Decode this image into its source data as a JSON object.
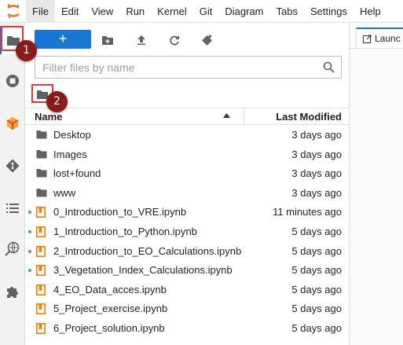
{
  "menubar": {
    "items": [
      "File",
      "Edit",
      "View",
      "Run",
      "Kernel",
      "Git",
      "Diagram",
      "Tabs",
      "Settings",
      "Help"
    ]
  },
  "activity_bar": {
    "icons": [
      "folder-icon",
      "stop-circle-icon",
      "extension-cube-icon",
      "git-icon",
      "list-icon",
      "map-search-icon",
      "puzzle-icon"
    ]
  },
  "toolbar": {
    "new_label": "+",
    "icons": [
      "new-folder-icon",
      "upload-icon",
      "refresh-icon",
      "git-clone-icon"
    ]
  },
  "search": {
    "placeholder": "Filter files by name"
  },
  "file_list": {
    "header_name": "Name",
    "header_modified": "Last Modified",
    "rows": [
      {
        "name": "Desktop",
        "type": "folder",
        "modified": "3 days ago",
        "running": false
      },
      {
        "name": "Images",
        "type": "folder",
        "modified": "3 days ago",
        "running": false
      },
      {
        "name": "lost+found",
        "type": "folder",
        "modified": "3 days ago",
        "running": false
      },
      {
        "name": "www",
        "type": "folder",
        "modified": "3 days ago",
        "running": false
      },
      {
        "name": "0_Introduction_to_VRE.ipynb",
        "type": "notebook",
        "modified": "11 minutes ago",
        "running": true
      },
      {
        "name": "1_Introduction_to_Python.ipynb",
        "type": "notebook",
        "modified": "5 days ago",
        "running": true
      },
      {
        "name": "2_Introduction_to_EO_Calculations.ipynb",
        "type": "notebook",
        "modified": "5 days ago",
        "running": true
      },
      {
        "name": "3_Vegetation_Index_Calculations.ipynb",
        "type": "notebook",
        "modified": "5 days ago",
        "running": true
      },
      {
        "name": "4_EO_Data_acces.ipynb",
        "type": "notebook",
        "modified": "5 days ago",
        "running": false
      },
      {
        "name": "5_Project_exercise.ipynb",
        "type": "notebook",
        "modified": "5 days ago",
        "running": false
      },
      {
        "name": "6_Project_solution.ipynb",
        "type": "notebook",
        "modified": "5 days ago",
        "running": false
      }
    ]
  },
  "launcher_tab": {
    "label": "Launc"
  },
  "annotations": {
    "badge1": "1",
    "badge2": "2"
  },
  "colors": {
    "accent": "#1976d2",
    "folder": "#616161",
    "notebook": "#f57c00",
    "running_dot": "#4caf50",
    "callout": "#e53935",
    "badge": "#8b1a1a"
  }
}
